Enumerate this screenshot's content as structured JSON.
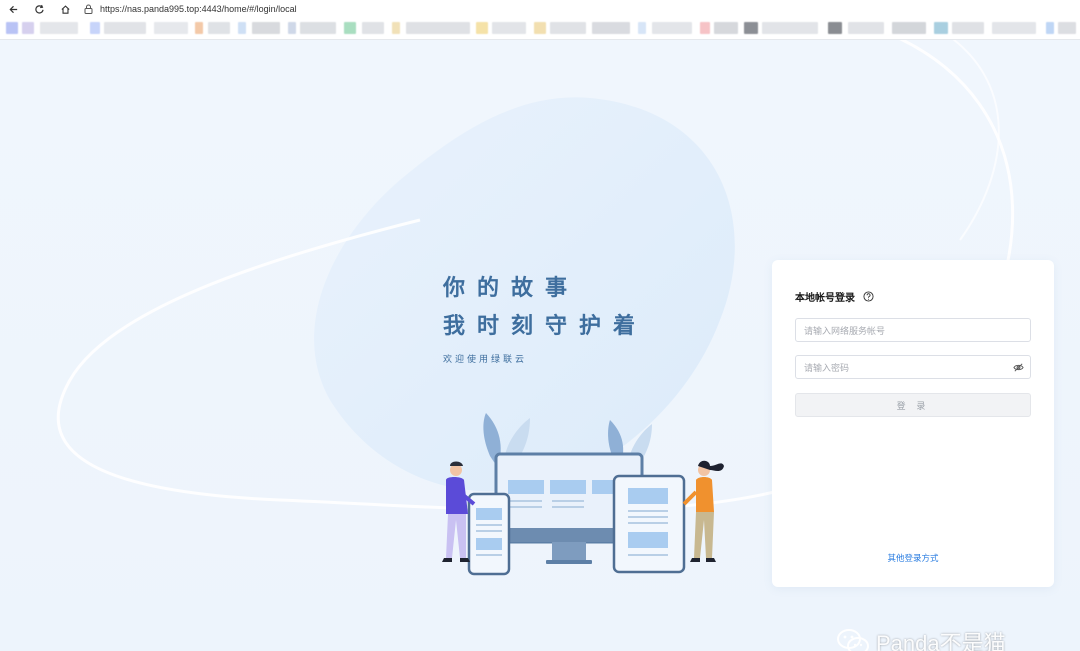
{
  "browser": {
    "url": "https://nas.panda995.top:4443/home/#/login/local",
    "nav_icons": [
      "back-icon",
      "reload-icon",
      "home-icon",
      "lock-icon"
    ]
  },
  "hero": {
    "slogan_line1": "你的故事",
    "slogan_line2": "我时刻守护着",
    "welcome": "欢迎使用绿联云"
  },
  "login": {
    "title": "本地帐号登录",
    "help_icon": "question-circle-icon",
    "username_placeholder": "请输入网络服务帐号",
    "password_placeholder": "请输入密码",
    "password_toggle_icon": "eye-off-icon",
    "submit_label": "登 录",
    "other_login": "其他登录方式"
  },
  "watermark": {
    "text": "Panda不是猫",
    "icon": "wechat-icon"
  },
  "colors": {
    "accent": "#2a7de1",
    "slogan": "#3e6e9e",
    "background": "#eef5fc"
  }
}
